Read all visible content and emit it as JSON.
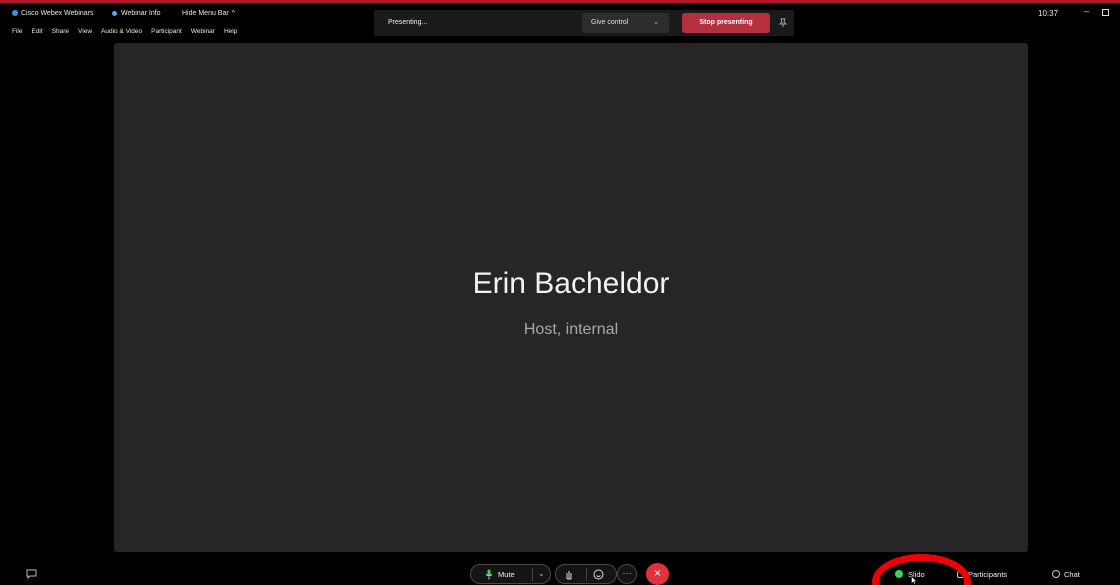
{
  "window": {
    "app_title": "Cisco Webex Webinars",
    "webinar_info": "Webinar Info",
    "hide_menu_bar": "Hide Menu Bar",
    "clock": "10:37"
  },
  "menubar": {
    "items": [
      "File",
      "Edit",
      "Share",
      "View",
      "Audio & Video",
      "Participant",
      "Webinar",
      "Help"
    ]
  },
  "sharing_bar": {
    "status": "Presenting...",
    "give_control": "Give control",
    "stop_presenting": "Stop presenting"
  },
  "stage": {
    "participant_name": "Erin Bacheldor",
    "participant_role": "Host, internal"
  },
  "controls": {
    "mute": "Mute",
    "slido": "Slido",
    "participants": "Participants",
    "chat": "Chat"
  },
  "colors": {
    "accent_red": "#b5303f",
    "leave_red": "#e0313e",
    "slido_green": "#3fd15a",
    "annotation_red": "#f00000"
  }
}
